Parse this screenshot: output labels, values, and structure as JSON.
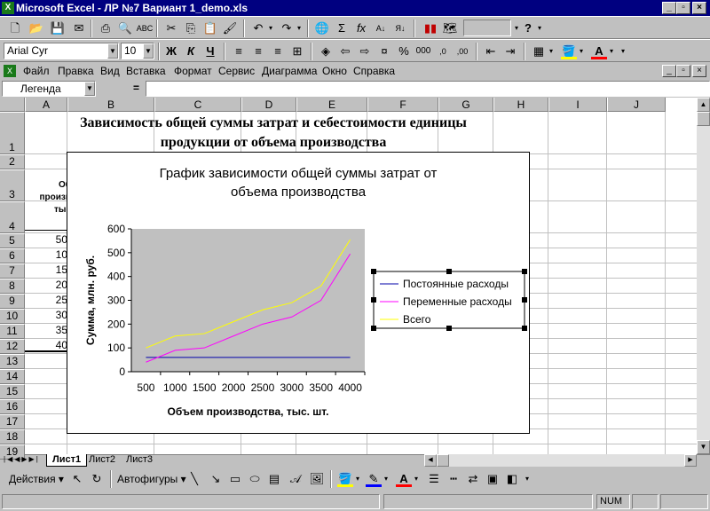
{
  "window": {
    "title": "Microsoft Excel - ЛР №7  Вариант 1_demo.xls",
    "app_icon": "excel-icon"
  },
  "toolbar_standard": {
    "zoom_value": ""
  },
  "toolbar_format": {
    "font_name": "Arial Cyr",
    "font_size": "10",
    "bold": "Ж",
    "italic": "К",
    "underline": "Ч",
    "percent": "%",
    "thousands": "000"
  },
  "menu": {
    "items": [
      "Файл",
      "Правка",
      "Вид",
      "Вставка",
      "Формат",
      "Сервис",
      "Диаграмма",
      "Окно",
      "Справка"
    ]
  },
  "formula_bar": {
    "name_box": "Легенда",
    "equals": "="
  },
  "columns": [
    "A",
    "B",
    "C",
    "D",
    "E",
    "F",
    "G",
    "H",
    "I",
    "J"
  ],
  "rows": [
    "1",
    "2",
    "3",
    "4",
    "5",
    "6",
    "7",
    "8",
    "9",
    "10",
    "11",
    "12",
    "13",
    "14",
    "15",
    "16",
    "17",
    "18",
    "19"
  ],
  "sheet": {
    "title_line1": "Зависимость общей суммы затрат и себестоимости единицы",
    "title_line2": "продукции от объема производства",
    "header_a1": "Об",
    "header_a2": "произв",
    "header_a3": "тыс",
    "a_values": [
      "50",
      "10",
      "15",
      "20",
      "25",
      "30",
      "35",
      "40"
    ]
  },
  "chart_data": {
    "type": "line",
    "title": "График зависимости общей суммы затрат от объема производства",
    "title_line1": "График зависимости общей суммы затрат от",
    "title_line2": "объема производства",
    "xlabel": "Объем производства, тыс. шт.",
    "ylabel": "Сумма, млн. руб.",
    "categories": [
      "500",
      "1000",
      "1500",
      "2000",
      "2500",
      "3000",
      "3500",
      "4000"
    ],
    "y_ticks": [
      "0",
      "100",
      "200",
      "300",
      "400",
      "500",
      "600"
    ],
    "ylim": [
      0,
      600
    ],
    "legend_position": "right",
    "plot_background": "#c0c0c0",
    "series": [
      {
        "name": "Постоянные расходы",
        "color": "#0000aa",
        "values": [
          60,
          60,
          60,
          60,
          60,
          60,
          60,
          60
        ]
      },
      {
        "name": "Переменные расходы",
        "color": "#ff00ff",
        "values": [
          40,
          90,
          100,
          150,
          200,
          230,
          300,
          495
        ]
      },
      {
        "name": "Всего",
        "color": "#ffff00",
        "values": [
          100,
          150,
          160,
          210,
          260,
          290,
          360,
          555
        ]
      }
    ]
  },
  "sheet_tabs": [
    "Лист1",
    "Лист2",
    "Лист3"
  ],
  "drawing_toolbar": {
    "actions_label": "Действия",
    "autoshapes_label": "Автофигуры"
  },
  "status_bar": {
    "num": "NUM"
  }
}
